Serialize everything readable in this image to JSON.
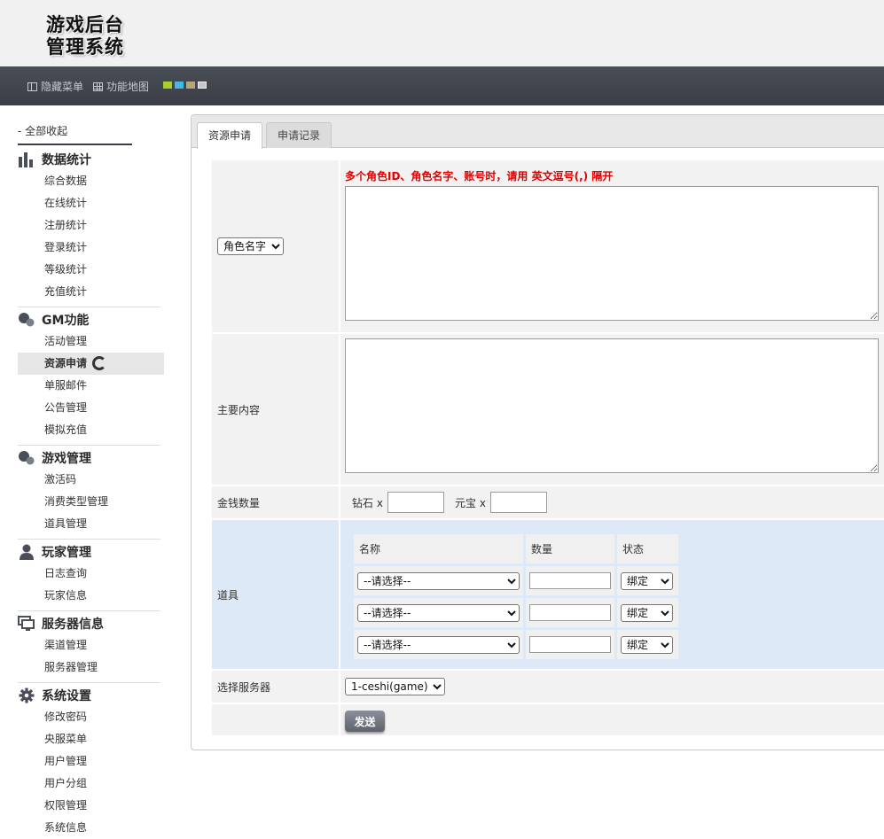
{
  "header": {
    "logo_line1": "游戏后台",
    "logo_line2": "管理系统"
  },
  "toolbar": {
    "hide_menu": "隐藏菜单",
    "function_map": "功能地图",
    "theme_colors": [
      "#a6cf2e",
      "#46b8e8",
      "#b9a57a",
      "#c7c7c7"
    ]
  },
  "sidebar": {
    "collapse_all": "- 全部收起",
    "groups": [
      {
        "title": "数据统计",
        "icon": "bar-chart-icon",
        "items": [
          "综合数据",
          "在线统计",
          "注册统计",
          "登录统计",
          "等级统计",
          "充值统计"
        ]
      },
      {
        "title": "GM功能",
        "icon": "bubbles-icon",
        "items": [
          "活动管理",
          "资源申请",
          "单服邮件",
          "公告管理",
          "模拟充值"
        ]
      },
      {
        "title": "游戏管理",
        "icon": "bubbles-icon",
        "items": [
          "激活码",
          "消费类型管理",
          "道具管理"
        ]
      },
      {
        "title": "玩家管理",
        "icon": "user-icon",
        "items": [
          "日志查询",
          "玩家信息"
        ]
      },
      {
        "title": "服务器信息",
        "icon": "monitor-icon",
        "items": [
          "渠道管理",
          "服务器管理"
        ]
      },
      {
        "title": "系统设置",
        "icon": "gear-icon",
        "items": [
          "修改密码",
          "央服菜单",
          "用户管理",
          "用户分组",
          "权限管理",
          "系统信息"
        ]
      }
    ],
    "active_item": "资源申请"
  },
  "tabs": {
    "apply": "资源申请",
    "records": "申请记录"
  },
  "form": {
    "target_type_selected": "角色名字",
    "hint": "多个角色ID、角色名字、账号时，请用 英文逗号(,) 隔开",
    "main_content_label": "主要内容",
    "money_label": "金钱数量",
    "diamond_label": "钻石 x",
    "yuanbao_label": "元宝 x",
    "items_label": "道具",
    "items_headers": {
      "name": "名称",
      "count": "数量",
      "status": "状态"
    },
    "item_select_placeholder": "--请选择--",
    "item_status_selected": "绑定",
    "server_label": "选择服务器",
    "server_selected": "1-ceshi(game)",
    "send_button": "发送"
  }
}
